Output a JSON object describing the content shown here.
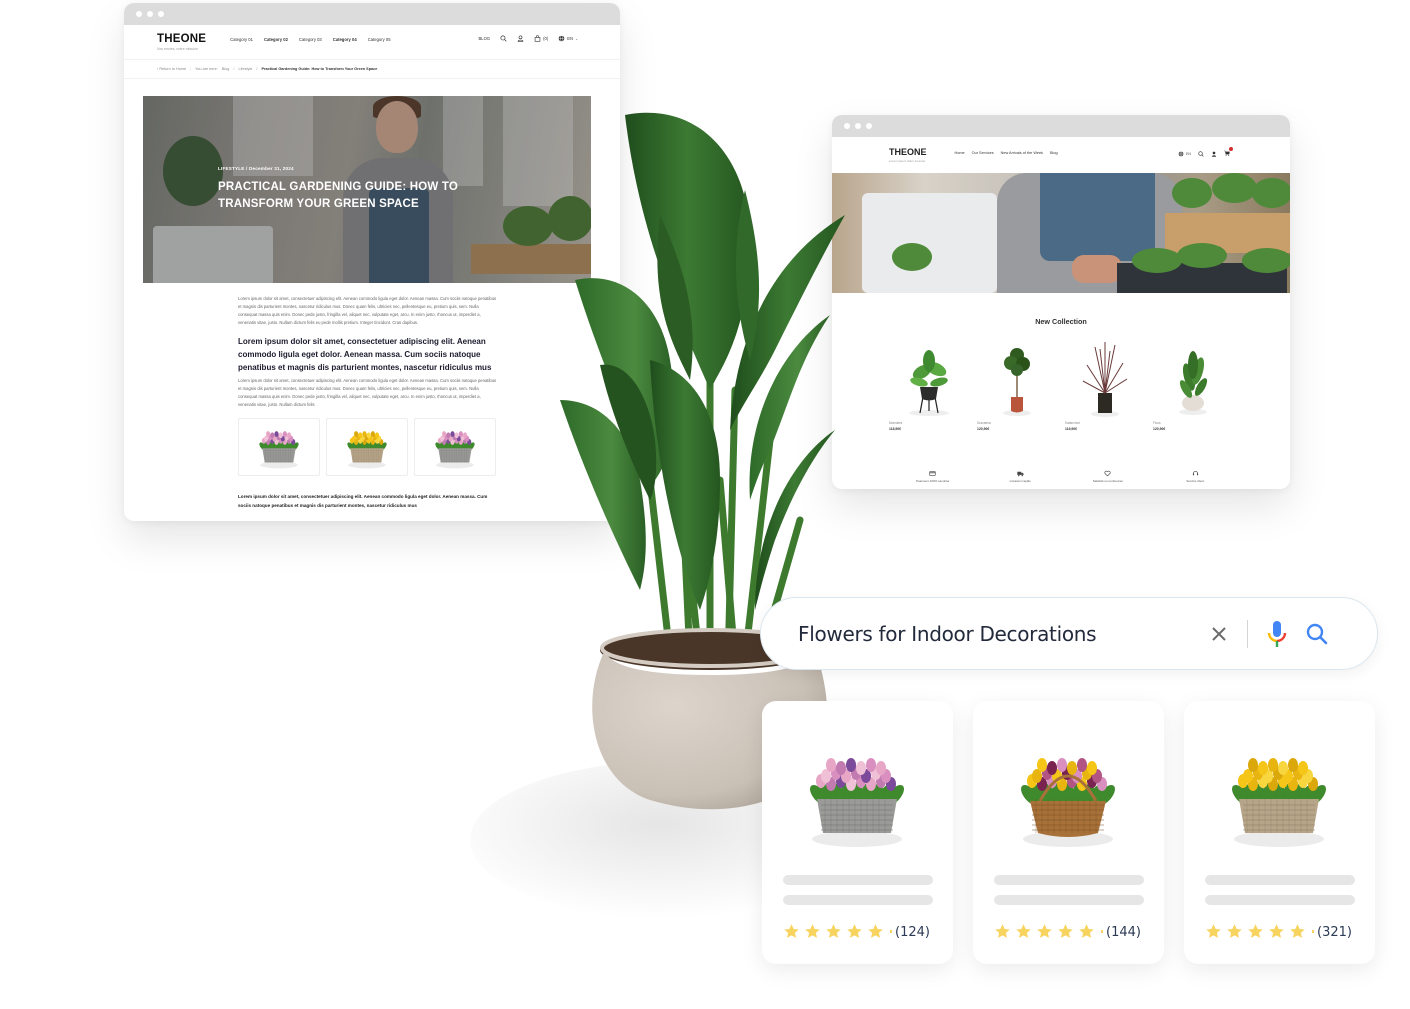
{
  "blog_window": {
    "logo": "THEONE",
    "tagline": "Vos envies, notre mission",
    "nav": [
      "Category 01",
      "Category 02",
      "Category 03",
      "Category 04",
      "Category 05"
    ],
    "right_links": {
      "blog": "BLOG",
      "cart_count": "(0)",
      "language": "EN"
    },
    "breadcrumb": {
      "back": "‹ Return to Home",
      "you_are_here": "You are here:",
      "path": [
        "Blog",
        "Lifestyle"
      ],
      "current": "Practical Gardening Guide: How to Transform Your Green Space"
    },
    "hero": {
      "category": "LIFESTYLE",
      "date": "December 31, 2024",
      "title": "PRACTICAL GARDENING GUIDE: HOW TO TRANSFORM YOUR GREEN SPACE"
    },
    "paragraph_1": "Lorem ipsum dolor sit amet, consectetuer adipiscing elit. Aenean commodo ligula eget dolor. Aenean massa. Cum sociis natoque penatibus et magnis dis parturient montes, nascetur ridiculus mus. Donec quam felis, ultricies nec, pellentesque eu, pretium quis, sem. Nulla consequat massa quis enim. Donec pede justo, fringilla vel, aliquet nec, vulputate eget, arcu. In enim justo, rhoncus ut, imperdiet a, venenatis vitae, justo. Nullam dictum felis eu pede mollis pretium. Integer tincidunt. Cras dapibus.",
    "heading": "Lorem ipsum dolor sit amet, consectetuer adipiscing elit. Aenean commodo ligula eget dolor. Aenean massa. Cum sociis natoque penatibus et magnis dis parturient montes, nascetur ridiculus mus",
    "paragraph_2": "Lorem ipsum dolor sit amet, consectetuer adipiscing elit. Aenean commodo ligula eget dolor. Aenean massa. Cum sociis natoque penatibus et magnis dis parturient montes, nascetur ridiculus mus. Donec quam felis, ultricies nec, pellentesque eu, pretium quis, sem. Nulla consequat massa quis enim. Donec pede justo, fringilla vel, aliquet nec, vulputate eget, arcu. In enim justo, rhoncus ut, imperdiet a, venenatis vitae, justo. Nullam dictum felis",
    "gallery": [
      "pink-tulips-grey-basket",
      "yellow-tulips-tan-basket",
      "pink-tulips-grey-basket"
    ],
    "footer_text": "Lorem ipsum dolor sit amet, consectetuer adipiscing elit. Aenean commodo ligula eget dolor. Aenean massa. Cum sociis natoque penatibus et magnis dis parturient montes, nascetur ridiculus mus"
  },
  "shop_window": {
    "logo": "THEONE",
    "tagline": "Lorem ipsum dolor sit amet",
    "nav": [
      "Home",
      "Our Services",
      "New Arrivals of the Week",
      "Blog"
    ],
    "language": "EN",
    "section_title": "New Collection",
    "products": [
      {
        "name": "Monstera",
        "price": "118,90€"
      },
      {
        "name": "Dracaena",
        "price": "120,90€"
      },
      {
        "name": "Kalanchoé",
        "price": "119,90€"
      },
      {
        "name": "Ficus",
        "price": "120,90€"
      }
    ],
    "features": [
      {
        "icon": "credit-card-icon",
        "label": "Paiement 100% sécurisé"
      },
      {
        "icon": "truck-icon",
        "label": "Livraison rapide"
      },
      {
        "icon": "heart-icon",
        "label": "Satisfait ou remboursé"
      },
      {
        "icon": "headset-icon",
        "label": "Service client"
      }
    ]
  },
  "search": {
    "query": "Flowers for Indoor Decorations",
    "colors": {
      "mic_blue": "#4285F4",
      "mic_red": "#EA4335",
      "mic_yellow": "#FBBC05",
      "mic_green": "#34A853",
      "lens": "#4285F4"
    }
  },
  "results": [
    {
      "image": "pink-tulips-grey-basket",
      "rating": 5,
      "reviews": "(124)"
    },
    {
      "image": "mixed-tulips-wicker-basket",
      "rating": 5,
      "reviews": "(144)"
    },
    {
      "image": "yellow-tulips-tan-basket",
      "rating": 5,
      "reviews": "(321)"
    }
  ],
  "colors": {
    "star": "#F7D35F",
    "skeleton": "#E6E6E6",
    "window_bar": "#DCDCDC"
  }
}
